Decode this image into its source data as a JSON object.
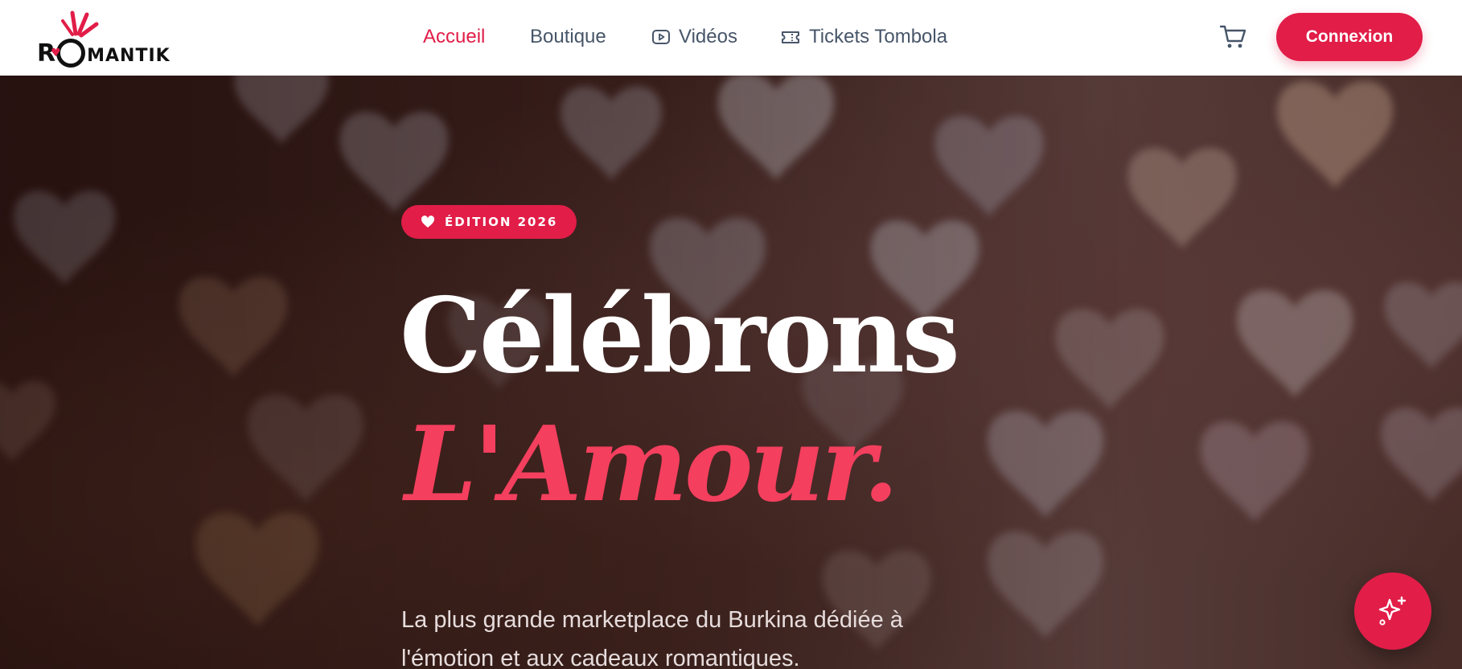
{
  "brand": {
    "logo_text": "ROMANTIK",
    "logo_first": "R",
    "logo_rest": "MANTIK",
    "accent_color": "#e11d48"
  },
  "nav": {
    "items": [
      {
        "label": "Accueil",
        "active": true
      },
      {
        "label": "Boutique",
        "active": false
      },
      {
        "label": "Vidéos",
        "icon": "play-video-icon",
        "active": false
      },
      {
        "label": "Tickets Tombola",
        "icon": "ticket-icon",
        "active": false
      }
    ]
  },
  "header": {
    "cart_icon": "shopping-cart-icon",
    "login_label": "Connexion"
  },
  "hero": {
    "badge": "ÉDITION 2026",
    "badge_icon": "heart-icon",
    "title_line1": "Célébrons",
    "title_line2": "L'Amour.",
    "subtitle": "La plus grande marketplace du Burkina dédiée à l'émotion et aux cadeaux romantiques.",
    "title_color": "#ffffff",
    "highlight_color": "#f43f5e"
  },
  "fab": {
    "icon": "sparkles-icon"
  }
}
